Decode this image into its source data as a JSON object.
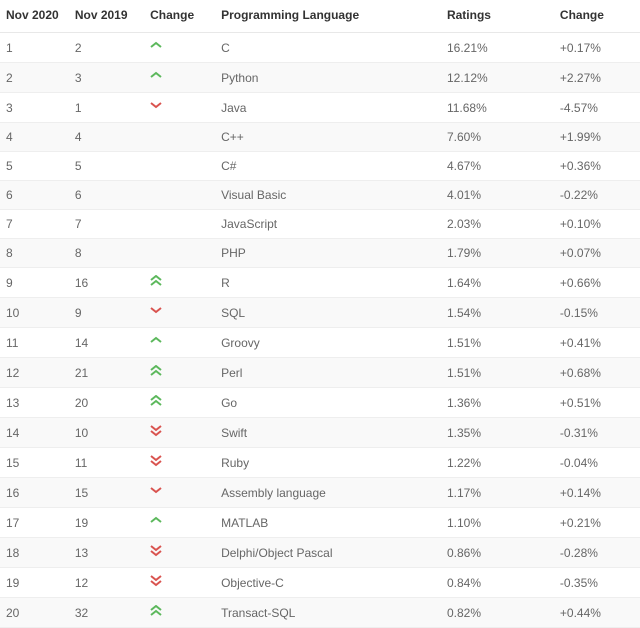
{
  "headers": {
    "nov2020": "Nov 2020",
    "nov2019": "Nov 2019",
    "changeIcon": "Change",
    "language": "Programming Language",
    "ratings": "Ratings",
    "change": "Change"
  },
  "colors": {
    "up": "#5cb85c",
    "down": "#d9534f"
  },
  "icons": {
    "up": "chevron-up-icon",
    "up2": "double-chevron-up-icon",
    "down": "chevron-down-icon",
    "down2": "double-chevron-down-icon",
    "none": ""
  },
  "rows": [
    {
      "nov2020": "1",
      "nov2019": "2",
      "trend": "up",
      "language": "C",
      "ratings": "16.21%",
      "change": "+0.17%"
    },
    {
      "nov2020": "2",
      "nov2019": "3",
      "trend": "up",
      "language": "Python",
      "ratings": "12.12%",
      "change": "+2.27%"
    },
    {
      "nov2020": "3",
      "nov2019": "1",
      "trend": "down",
      "language": "Java",
      "ratings": "11.68%",
      "change": "-4.57%"
    },
    {
      "nov2020": "4",
      "nov2019": "4",
      "trend": "none",
      "language": "C++",
      "ratings": "7.60%",
      "change": "+1.99%"
    },
    {
      "nov2020": "5",
      "nov2019": "5",
      "trend": "none",
      "language": "C#",
      "ratings": "4.67%",
      "change": "+0.36%"
    },
    {
      "nov2020": "6",
      "nov2019": "6",
      "trend": "none",
      "language": "Visual Basic",
      "ratings": "4.01%",
      "change": "-0.22%"
    },
    {
      "nov2020": "7",
      "nov2019": "7",
      "trend": "none",
      "language": "JavaScript",
      "ratings": "2.03%",
      "change": "+0.10%"
    },
    {
      "nov2020": "8",
      "nov2019": "8",
      "trend": "none",
      "language": "PHP",
      "ratings": "1.79%",
      "change": "+0.07%"
    },
    {
      "nov2020": "9",
      "nov2019": "16",
      "trend": "up2",
      "language": "R",
      "ratings": "1.64%",
      "change": "+0.66%"
    },
    {
      "nov2020": "10",
      "nov2019": "9",
      "trend": "down",
      "language": "SQL",
      "ratings": "1.54%",
      "change": "-0.15%"
    },
    {
      "nov2020": "11",
      "nov2019": "14",
      "trend": "up",
      "language": "Groovy",
      "ratings": "1.51%",
      "change": "+0.41%"
    },
    {
      "nov2020": "12",
      "nov2019": "21",
      "trend": "up2",
      "language": "Perl",
      "ratings": "1.51%",
      "change": "+0.68%"
    },
    {
      "nov2020": "13",
      "nov2019": "20",
      "trend": "up2",
      "language": "Go",
      "ratings": "1.36%",
      "change": "+0.51%"
    },
    {
      "nov2020": "14",
      "nov2019": "10",
      "trend": "down2",
      "language": "Swift",
      "ratings": "1.35%",
      "change": "-0.31%"
    },
    {
      "nov2020": "15",
      "nov2019": "11",
      "trend": "down2",
      "language": "Ruby",
      "ratings": "1.22%",
      "change": "-0.04%"
    },
    {
      "nov2020": "16",
      "nov2019": "15",
      "trend": "down",
      "language": "Assembly language",
      "ratings": "1.17%",
      "change": "+0.14%"
    },
    {
      "nov2020": "17",
      "nov2019": "19",
      "trend": "up",
      "language": "MATLAB",
      "ratings": "1.10%",
      "change": "+0.21%"
    },
    {
      "nov2020": "18",
      "nov2019": "13",
      "trend": "down2",
      "language": "Delphi/Object Pascal",
      "ratings": "0.86%",
      "change": "-0.28%"
    },
    {
      "nov2020": "19",
      "nov2019": "12",
      "trend": "down2",
      "language": "Objective-C",
      "ratings": "0.84%",
      "change": "-0.35%"
    },
    {
      "nov2020": "20",
      "nov2019": "32",
      "trend": "up2",
      "language": "Transact-SQL",
      "ratings": "0.82%",
      "change": "+0.44%"
    }
  ]
}
